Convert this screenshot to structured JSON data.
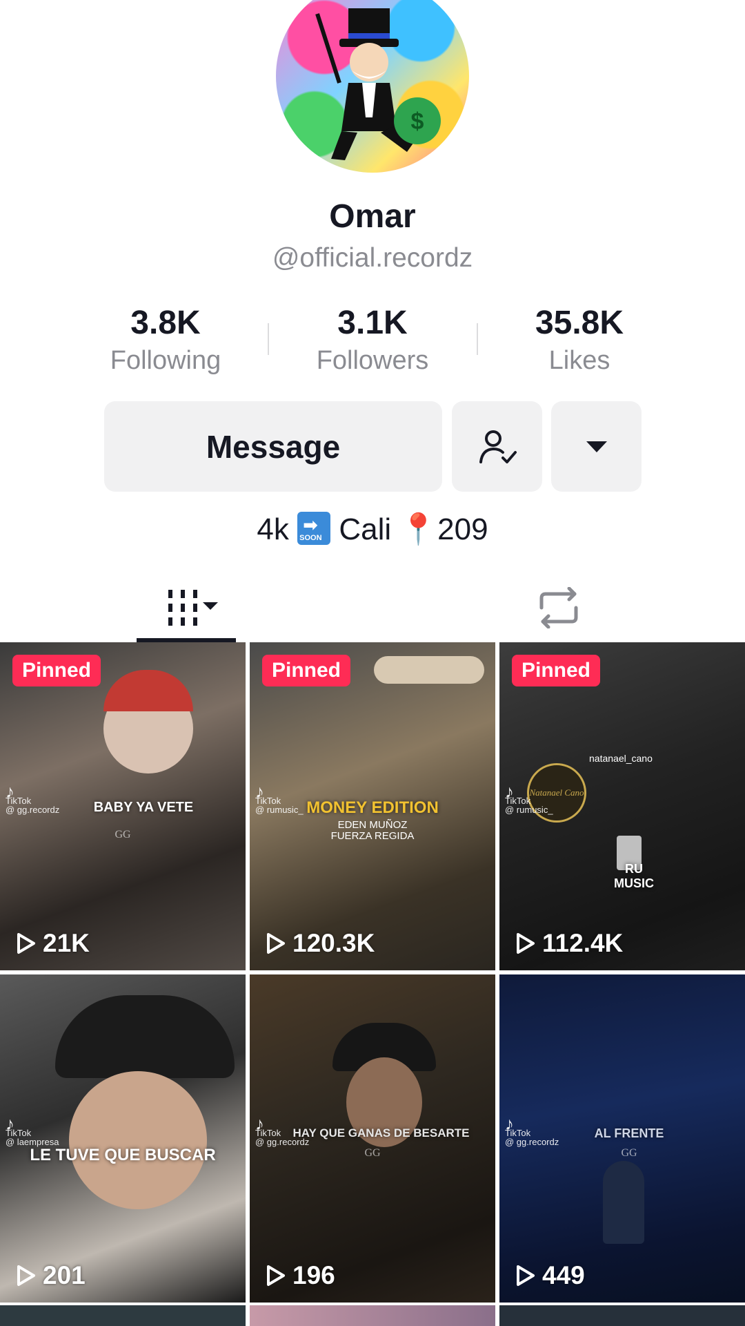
{
  "profile": {
    "name": "Omar",
    "handle": "@official.recordz",
    "bio_prefix": "4k",
    "bio_soon": "SOON",
    "bio_suffix": "Cali 📍209"
  },
  "stats": [
    {
      "value": "3.8K",
      "label": "Following"
    },
    {
      "value": "3.1K",
      "label": "Followers"
    },
    {
      "value": "35.8K",
      "label": "Likes"
    }
  ],
  "actions": {
    "message_label": "Message",
    "following_icon": "user-check-icon",
    "more_icon": "caret-down-icon"
  },
  "tabs": {
    "videos_icon": "videos-grid-icon",
    "reposts_icon": "repost-icon"
  },
  "videos": [
    {
      "pinned_label": "Pinned",
      "views": "21K",
      "caption": "BABY YA VETE",
      "watermark": "@ gg.recordz",
      "tag": "GG"
    },
    {
      "pinned_label": "Pinned",
      "views": "120.3K",
      "caption": "MONEY EDITION",
      "sub1": "EDEN MUÑOZ",
      "sub2": "FUERZA REGIDA",
      "watermark": "@ rumusic_"
    },
    {
      "pinned_label": "Pinned",
      "views": "112.4K",
      "caption": "RU MUSIC",
      "user": "natanael_cano",
      "logo": "Natanael Cano",
      "watermark": "@ rumusic_"
    },
    {
      "views": "201",
      "caption": "LE TUVE QUE BUSCAR",
      "watermark": "@ laempresa"
    },
    {
      "views": "196",
      "caption": "HAY QUE GANAS DE BESARTE",
      "watermark": "@ gg.recordz",
      "tag": "GG"
    },
    {
      "views": "449",
      "caption": "AL FRENTE",
      "watermark": "@ gg.recordz",
      "tag": "GG"
    }
  ],
  "tiktok_label": "TikTok",
  "colors": {
    "accent": "#fe2c55",
    "button_bg": "#f1f1f2",
    "text_secondary": "#8a8b91"
  }
}
